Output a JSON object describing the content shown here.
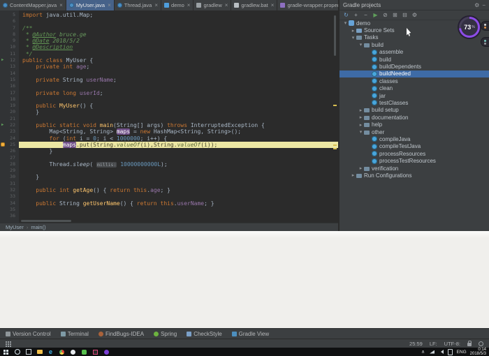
{
  "tabs": [
    {
      "label": "ContentMapper.java",
      "icon": "java-class",
      "selected": false
    },
    {
      "label": "MyUser.java",
      "icon": "java-class",
      "selected": true
    },
    {
      "label": "Thread.java",
      "icon": "java-class",
      "selected": false
    },
    {
      "label": "demo",
      "icon": "gradle",
      "selected": false
    },
    {
      "label": "gradlew",
      "icon": "file",
      "selected": false
    },
    {
      "label": "gradlew.bat",
      "icon": "bat",
      "selected": false
    },
    {
      "label": "gradle-wrapper.properties",
      "icon": "properties",
      "selected": false
    }
  ],
  "editor": {
    "breadcrumb": [
      "MyUser",
      "main()"
    ],
    "lines": [
      {
        "n": 5,
        "tk": [
          [
            "import ",
            "k"
          ],
          [
            "java.util.Map;",
            "p"
          ]
        ]
      },
      {
        "n": 6,
        "tk": []
      },
      {
        "n": 7,
        "tk": [
          [
            "/**",
            "d"
          ]
        ]
      },
      {
        "n": 8,
        "tk": [
          [
            " * ",
            "d"
          ],
          [
            "@Author",
            "dt"
          ],
          [
            " bruce.ge",
            "di"
          ]
        ]
      },
      {
        "n": 9,
        "tk": [
          [
            " * ",
            "d"
          ],
          [
            "@Date",
            "dt"
          ],
          [
            " 2018/5/2",
            "di"
          ]
        ]
      },
      {
        "n": 10,
        "tk": [
          [
            " * ",
            "d"
          ],
          [
            "@Description",
            "dt"
          ]
        ]
      },
      {
        "n": 11,
        "tk": [
          [
            " */",
            "d"
          ]
        ]
      },
      {
        "n": 12,
        "mark": "run",
        "tk": [
          [
            "public class ",
            "k"
          ],
          [
            "MyUser {",
            "p"
          ]
        ]
      },
      {
        "n": 13,
        "tk": [
          [
            "    private int ",
            "k"
          ],
          [
            "age",
            "f"
          ],
          [
            ";",
            "p"
          ]
        ]
      },
      {
        "n": 14,
        "tk": []
      },
      {
        "n": 15,
        "tk": [
          [
            "    private ",
            "k"
          ],
          [
            "String ",
            "p"
          ],
          [
            "userName",
            "f"
          ],
          [
            ";",
            "p"
          ]
        ]
      },
      {
        "n": 16,
        "tk": []
      },
      {
        "n": 17,
        "tk": [
          [
            "    private long ",
            "k"
          ],
          [
            "userId",
            "f"
          ],
          [
            ";",
            "p"
          ]
        ]
      },
      {
        "n": 18,
        "tk": []
      },
      {
        "n": 19,
        "tk": [
          [
            "    public ",
            "k"
          ],
          [
            "MyUser",
            "m"
          ],
          [
            "() {",
            "p"
          ]
        ]
      },
      {
        "n": 20,
        "tk": [
          [
            "    }",
            "p"
          ]
        ]
      },
      {
        "n": 21,
        "tk": []
      },
      {
        "n": 22,
        "mark": "run",
        "tk": [
          [
            "    public static void ",
            "k"
          ],
          [
            "main",
            "m"
          ],
          [
            "(String[] args) ",
            "p"
          ],
          [
            "throws",
            "k"
          ],
          [
            " InterruptedException {",
            "p"
          ]
        ]
      },
      {
        "n": 23,
        "tk": [
          [
            "        Map<String, String> ",
            "p"
          ],
          [
            "maps",
            "pill"
          ],
          [
            " = ",
            "p"
          ],
          [
            "new ",
            "k"
          ],
          [
            "HashMap<String, String>();",
            "p"
          ]
        ]
      },
      {
        "n": 24,
        "tk": [
          [
            "        for ",
            "k"
          ],
          [
            "(",
            "p"
          ],
          [
            "int ",
            "k"
          ],
          [
            "i = ",
            "p"
          ],
          [
            "0",
            "n"
          ],
          [
            "; i < ",
            "p"
          ],
          [
            "1000000",
            "n"
          ],
          [
            "; i++) {",
            "p"
          ]
        ]
      },
      {
        "n": 25,
        "hl": true,
        "bookmark": true,
        "tk": [
          [
            "            ",
            "p"
          ],
          [
            "maps",
            "pill"
          ],
          [
            ".put(String.",
            "p"
          ],
          [
            "valueOf",
            "i"
          ],
          [
            "(i),String.",
            "p"
          ],
          [
            "valueOf",
            "i"
          ],
          [
            "(i));",
            "p"
          ]
        ]
      },
      {
        "n": 26,
        "tk": [
          [
            "        }",
            "p"
          ]
        ]
      },
      {
        "n": 27,
        "tk": []
      },
      {
        "n": 28,
        "tk": [
          [
            "        Thread.",
            "p"
          ],
          [
            "sleep",
            "i"
          ],
          [
            "( ",
            "p"
          ],
          [
            "millis:",
            "h"
          ],
          [
            " ",
            "p"
          ],
          [
            "10000000000L",
            "n"
          ],
          [
            ");",
            "p"
          ]
        ]
      },
      {
        "n": 29,
        "tk": []
      },
      {
        "n": 30,
        "tk": [
          [
            "    }",
            "p"
          ]
        ]
      },
      {
        "n": 31,
        "tk": []
      },
      {
        "n": 32,
        "tk": [
          [
            "    public int ",
            "k"
          ],
          [
            "getAge",
            "m"
          ],
          [
            "() { ",
            "p"
          ],
          [
            "return ",
            "k"
          ],
          [
            "this",
            "k"
          ],
          [
            ".",
            "p"
          ],
          [
            "age",
            "f"
          ],
          [
            "; }",
            "p"
          ]
        ]
      },
      {
        "n": 33,
        "tk": []
      },
      {
        "n": 34,
        "tk": [
          [
            "    public ",
            "k"
          ],
          [
            "String ",
            "p"
          ],
          [
            "getUserName",
            "m"
          ],
          [
            "() { ",
            "p"
          ],
          [
            "return ",
            "k"
          ],
          [
            "this",
            "k"
          ],
          [
            ".",
            "p"
          ],
          [
            "userName",
            "f"
          ],
          [
            "; }",
            "p"
          ]
        ]
      },
      {
        "n": 35,
        "tk": []
      },
      {
        "n": 36,
        "tk": []
      }
    ]
  },
  "gradle_panel": {
    "title": "Gradle projects",
    "header_icons": [
      "settings-icon",
      "hide-panel-icon"
    ],
    "toolbar_icons": [
      "refresh-icon",
      "attach-project-icon",
      "detach-project-icon",
      "run-task-icon",
      "offline-mode-icon",
      "expand-all-icon",
      "collapse-all-icon",
      "settings-icon"
    ],
    "tree": [
      {
        "label": "demo",
        "depth": 0,
        "chevron": "down",
        "icon": "project"
      },
      {
        "label": "Source Sets",
        "depth": 1,
        "chevron": "right",
        "icon": "sources"
      },
      {
        "label": "Tasks",
        "depth": 1,
        "chevron": "down",
        "icon": "folder"
      },
      {
        "label": "build",
        "depth": 2,
        "chevron": "down",
        "icon": "folder"
      },
      {
        "label": "assemble",
        "depth": 3,
        "chevron": "none",
        "icon": "task"
      },
      {
        "label": "build",
        "depth": 3,
        "chevron": "none",
        "icon": "task"
      },
      {
        "label": "buildDependents",
        "depth": 3,
        "chevron": "none",
        "icon": "task"
      },
      {
        "label": "buildNeeded",
        "depth": 3,
        "chevron": "none",
        "icon": "task",
        "selected": true
      },
      {
        "label": "classes",
        "depth": 3,
        "chevron": "none",
        "icon": "task"
      },
      {
        "label": "clean",
        "depth": 3,
        "chevron": "none",
        "icon": "task"
      },
      {
        "label": "jar",
        "depth": 3,
        "chevron": "none",
        "icon": "task"
      },
      {
        "label": "testClasses",
        "depth": 3,
        "chevron": "none",
        "icon": "task"
      },
      {
        "label": "build setup",
        "depth": 2,
        "chevron": "right",
        "icon": "folder"
      },
      {
        "label": "documentation",
        "depth": 2,
        "chevron": "right",
        "icon": "folder"
      },
      {
        "label": "help",
        "depth": 2,
        "chevron": "right",
        "icon": "folder"
      },
      {
        "label": "other",
        "depth": 2,
        "chevron": "down",
        "icon": "folder"
      },
      {
        "label": "compileJava",
        "depth": 3,
        "chevron": "none",
        "icon": "task"
      },
      {
        "label": "compileTestJava",
        "depth": 3,
        "chevron": "none",
        "icon": "task"
      },
      {
        "label": "processResources",
        "depth": 3,
        "chevron": "none",
        "icon": "task"
      },
      {
        "label": "processTestResources",
        "depth": 3,
        "chevron": "none",
        "icon": "task"
      },
      {
        "label": "verification",
        "depth": 2,
        "chevron": "right",
        "icon": "folder"
      },
      {
        "label": "Run Configurations",
        "depth": 1,
        "chevron": "right",
        "icon": "folder"
      }
    ]
  },
  "toolwindow_bar": [
    {
      "label": "Version Control",
      "icon": "version-control"
    },
    {
      "label": "Terminal",
      "icon": "terminal"
    },
    {
      "label": "FindBugs-IDEA",
      "icon": "findbugs"
    },
    {
      "label": "Spring",
      "icon": "spring"
    },
    {
      "label": "CheckStyle",
      "icon": "checkstyle"
    },
    {
      "label": "Gradle View",
      "icon": "gradle"
    }
  ],
  "status_bar": {
    "caret_position": "25:59",
    "line_separator": "LF:",
    "encoding": "UTF-8:"
  },
  "overlay": {
    "recorder_percent": "73",
    "percent_symbol": "%"
  },
  "taskbar": {
    "left_icons": [
      "start-icon",
      "cortana-icon",
      "task-view-icon",
      "file-explorer-icon",
      "edge-icon",
      "chrome-icon",
      "qq-icon",
      "wechat-icon",
      "intellij-icon",
      "recorder-icon"
    ],
    "tray_icons": [
      "tray-expand-icon",
      "network-icon",
      "volume-icon"
    ],
    "input_language": "ENG",
    "time": "0:14",
    "date": "2018/5/3"
  }
}
